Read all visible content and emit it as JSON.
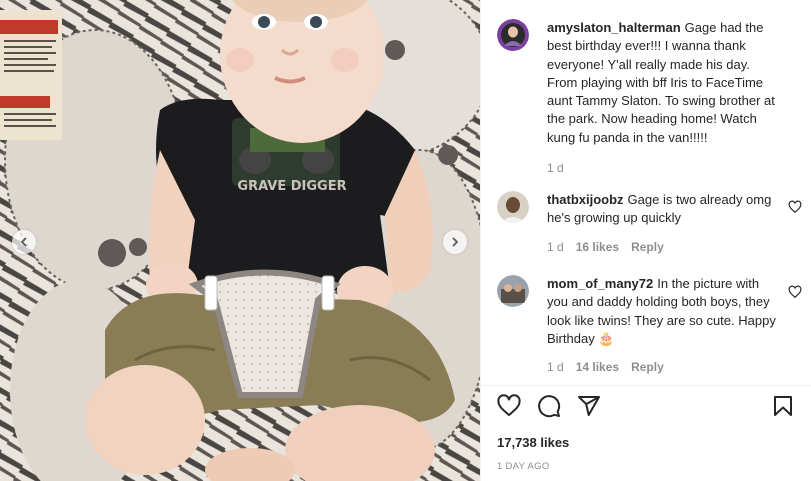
{
  "post": {
    "author": "amyslaton_halterman",
    "caption": "Gage had the best birthday ever!!! I wanna thank everyone! Y'all really made his day. From playing with bff Iris to FaceTime aunt Tammy Slaton. To swing brother at the park. Now heading home! Watch kung fu panda in the van!!!!!",
    "time": "1 d"
  },
  "photo": {
    "shirt_text": "GRAVE DIGGER"
  },
  "comments": [
    {
      "username": "thatbxijoobz",
      "text": "Gage is two already omg he's growing up quickly",
      "time": "1 d",
      "likes": "16 likes",
      "reply": "Reply"
    },
    {
      "username": "mom_of_many72",
      "text": "In the picture with you and daddy holding both boys, they look like twins! They are so cute. Happy Birthday",
      "emoji": "🎂",
      "time": "1 d",
      "likes": "14 likes",
      "reply": "Reply"
    }
  ],
  "stats": {
    "likes": "17,738 likes",
    "date": "1 DAY AGO"
  },
  "icons": {
    "like": "heart-icon",
    "comment": "comment-icon",
    "share": "share-icon",
    "save": "bookmark-icon",
    "prev": "chevron-left-icon",
    "next": "chevron-right-icon"
  }
}
